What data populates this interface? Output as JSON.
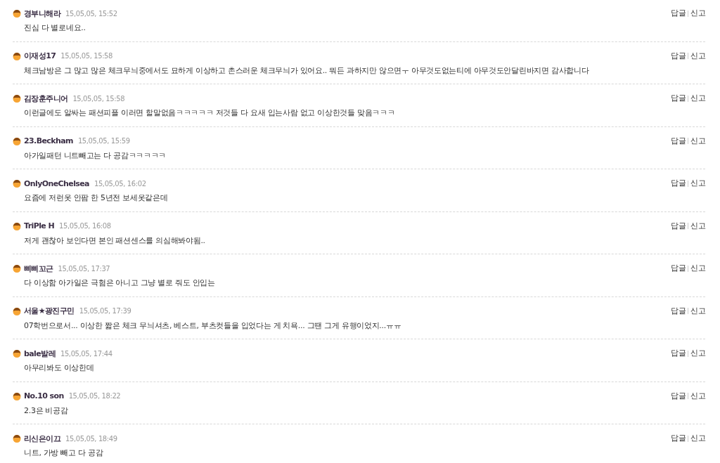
{
  "comments": [
    {
      "author": "경부니해라",
      "time": "15,05,05, 15:52",
      "text": "진심 다 별로네요..",
      "actions": [
        "답글",
        "신고"
      ]
    },
    {
      "author": "이재성17",
      "time": "15,05,05, 15:58",
      "text": "체크남방은 그 많고 많은 체크무늬중에서도 묘하게 이상하고 촌스러운 체크무늬가 있어요.. 뭐든 과하지만 않으면ㅜ 아무것도없는티에 아무것도안달린바지면 감사합니다",
      "actions": [
        "답글",
        "신고"
      ]
    },
    {
      "author": "김장훈주니어",
      "time": "15,05,05, 15:58",
      "text": "이런글에도 알싸는 패션피플 이러면 할말없음ㅋㅋㅋㅋㅋ 저것들 다 요새 입는사람 없고 이상한것들 맞음ㅋㅋㅋ",
      "actions": [
        "답글",
        "신고"
      ]
    },
    {
      "author": "23.Beckham",
      "time": "15,05,05, 15:59",
      "text": "아가일패턴 니트빼고는 다 공감ㅋㅋㅋㅋㅋ",
      "actions": [
        "답글",
        "신고"
      ]
    },
    {
      "author": "OnlyOneChelsea",
      "time": "15,05,05, 16:02",
      "text": "요즘에 저런옷 안팜 한 5년전 보세옷같은데",
      "actions": [
        "답글",
        "신고"
      ]
    },
    {
      "author": "TriPle H",
      "time": "15,05,05, 16:08",
      "text": "저게 괜찮아 보인다면 본인 패션센스를 의심해봐야됨..",
      "actions": [
        "답글",
        "신고"
      ]
    },
    {
      "author": "삐삐꼬근",
      "time": "15,05,05, 17:37",
      "text": "다 이상함 아가일은 극혐은 아니고 그냥 별로 줘도 안입는",
      "actions": [
        "답글",
        "신고"
      ]
    },
    {
      "author": "서울★광진구민",
      "time": "15,05,05, 17:39",
      "text": "07학번으로서... 이상한 짧은 체크 무늬셔츠, 베스트, 부츠컷들을 입었다는 게 치욕... 그땐 그게 유행이었지...ㅠㅠ",
      "actions": [
        "답글",
        "신고"
      ]
    },
    {
      "author": "bale발레",
      "time": "15,05,05, 17:44",
      "text": "아무리봐도 이상한데",
      "actions": [
        "답글",
        "신고"
      ]
    },
    {
      "author": "No.10 son",
      "time": "15,05,05, 18:22",
      "text": "2.3은 비공감",
      "actions": [
        "답글",
        "신고"
      ]
    },
    {
      "author": "리신은이끄",
      "time": "15,05,05, 18:49",
      "text": "니트, 가방 빼고 다 공감",
      "actions": [
        "답글",
        "신고"
      ]
    }
  ]
}
